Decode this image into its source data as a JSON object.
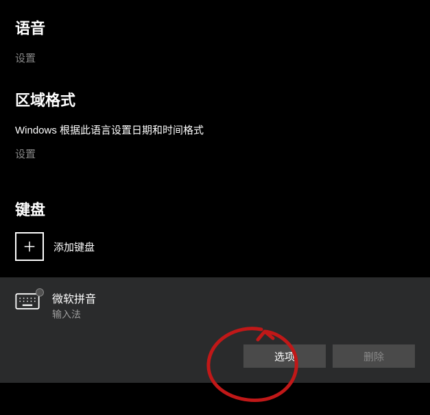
{
  "sections": {
    "speech": {
      "heading": "语音",
      "settings_link": "设置"
    },
    "region_format": {
      "heading": "区域格式",
      "description": "Windows 根据此语言设置日期和时间格式",
      "settings_link": "设置"
    },
    "keyboard": {
      "heading": "键盘",
      "add_label": "添加键盘",
      "ime": {
        "name": "微软拼音",
        "subtitle": "输入法",
        "options_button": "选项",
        "remove_button": "删除"
      }
    }
  }
}
